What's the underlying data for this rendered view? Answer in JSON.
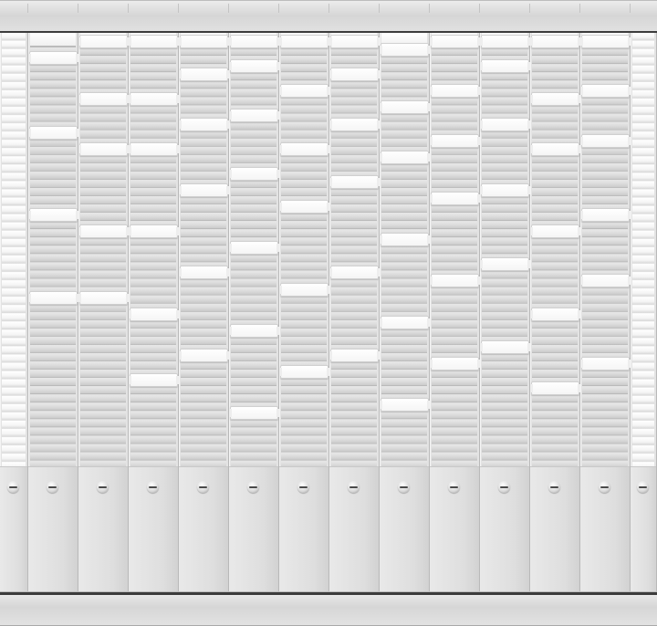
{
  "board": {
    "column_count": 12,
    "colors": {
      "frame": "#e0e0e0",
      "slot": "#d8d8d8",
      "card": "#ffffff",
      "groove": "#3c3c3c"
    },
    "columns": [
      {
        "cards": [
          2,
          11,
          21,
          31
        ]
      },
      {
        "cards": [
          0,
          7,
          13,
          23,
          31
        ]
      },
      {
        "cards": [
          0,
          7,
          13,
          23,
          33,
          41
        ]
      },
      {
        "cards": [
          0,
          4,
          10,
          18,
          28,
          38
        ]
      },
      {
        "cards": [
          0,
          3,
          9,
          16,
          25,
          35,
          45
        ]
      },
      {
        "cards": [
          0,
          6,
          13,
          20,
          30,
          40
        ]
      },
      {
        "cards": [
          0,
          4,
          10,
          17,
          28,
          38
        ]
      },
      {
        "cards": [
          1,
          8,
          14,
          24,
          34,
          44
        ]
      },
      {
        "cards": [
          0,
          6,
          12,
          19,
          29,
          39
        ]
      },
      {
        "cards": [
          0,
          3,
          10,
          18,
          27,
          37
        ]
      },
      {
        "cards": [
          0,
          7,
          13,
          23,
          33,
          42
        ]
      },
      {
        "cards": [
          0,
          6,
          12,
          21,
          29,
          39
        ]
      }
    ]
  }
}
